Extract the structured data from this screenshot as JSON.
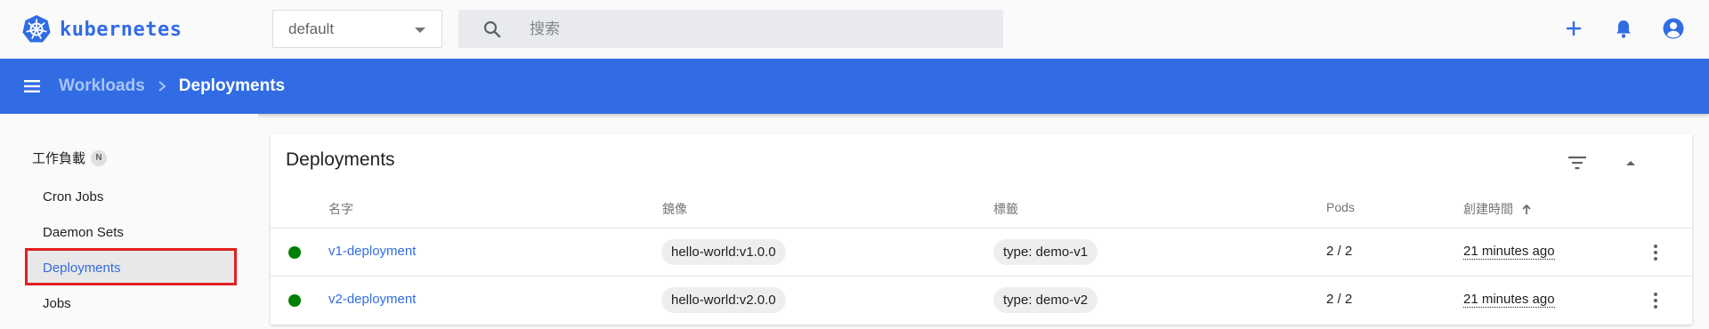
{
  "header": {
    "brand": "kubernetes",
    "namespace": {
      "selected": "default"
    },
    "search": {
      "placeholder": "搜索"
    },
    "actions": [
      "plus-icon",
      "bell-icon",
      "account-icon"
    ]
  },
  "breadcrumb": {
    "parent": "Workloads",
    "current": "Deployments"
  },
  "sidebar": {
    "header": "工作負載",
    "badge": "N",
    "items": [
      {
        "label": "Cron Jobs"
      },
      {
        "label": "Daemon Sets"
      },
      {
        "label": "Deployments",
        "active": true
      },
      {
        "label": "Jobs"
      }
    ]
  },
  "deployments": {
    "title": "Deployments",
    "columns": {
      "name": "名字",
      "images": "鏡像",
      "labels": "標籤",
      "pods": "Pods",
      "created": "創建時間"
    },
    "rows": [
      {
        "status": "running",
        "name": "v1-deployment",
        "image": "hello-world:v1.0.0",
        "label": "type: demo-v1",
        "pods": "2 / 2",
        "created": "21 minutes ago"
      },
      {
        "status": "running",
        "name": "v2-deployment",
        "image": "hello-world:v2.0.0",
        "label": "type: demo-v2",
        "pods": "2 / 2",
        "created": "21 minutes ago"
      }
    ]
  },
  "colors": {
    "brand": "#326ce5",
    "status_ok": "#008000",
    "highlight": "#e02020"
  }
}
